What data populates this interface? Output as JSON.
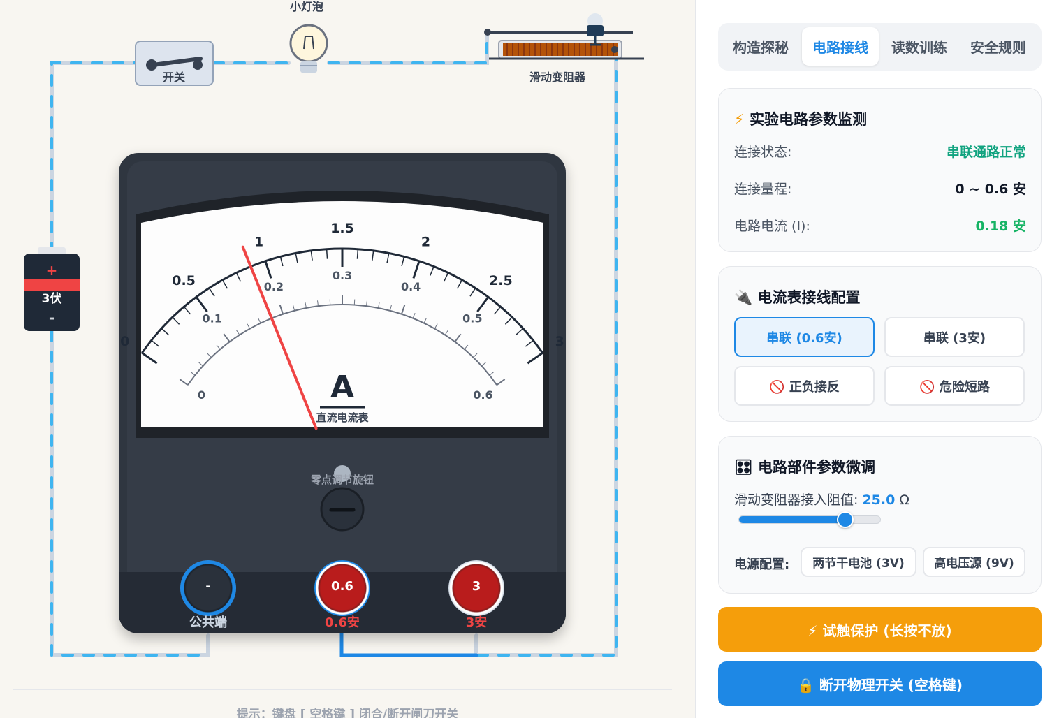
{
  "circuit": {
    "bulb_label": "小灯泡",
    "switch_label": "开关",
    "rheostat_label": "滑动变阻器",
    "battery": {
      "plus": "+",
      "voltage": "3伏",
      "minus": "-"
    },
    "hint": "提示：键盘 [ 空格键 ] 闭合/断开闸刀开关"
  },
  "meter": {
    "unit": "A",
    "name": "直流电流表",
    "zero_knob": "零点调节旋钮",
    "needle_reading": 0.18,
    "outer_scale": [
      "0",
      "0.5",
      "1",
      "1.5",
      "2",
      "2.5",
      "3"
    ],
    "inner_scale": [
      "0",
      "0.1",
      "0.2",
      "0.3",
      "0.4",
      "0.5",
      "0.6"
    ],
    "terminals": [
      {
        "symbol": "-",
        "label": "公共端"
      },
      {
        "symbol": "0.6",
        "label": "0.6安"
      },
      {
        "symbol": "3",
        "label": "3安"
      }
    ]
  },
  "tabs": [
    "构造探秘",
    "电路接线",
    "读数训练",
    "安全规则"
  ],
  "active_tab": "电路接线",
  "monitor": {
    "icon": "⚡",
    "title": "实验电路参数监测",
    "rows": [
      {
        "key": "连接状态:",
        "value": "串联通路正常",
        "color": "#10a37f"
      },
      {
        "key": "连接量程:",
        "value": "0 ~ 0.6 安",
        "color": "#111827"
      },
      {
        "key": "电路电流 (I):",
        "value": "0.18 安",
        "color": "#16b364"
      }
    ]
  },
  "wiring": {
    "icon": "🔌",
    "title": "电流表接线配置",
    "options": [
      "串联 (0.6安)",
      "串联 (3安)",
      "🚫 正负接反",
      "🚫 危险短路"
    ],
    "selected": "串联 (0.6安)"
  },
  "tuning": {
    "icon": "🎛",
    "title": "电路部件参数微调",
    "rheostat_label": "滑动变阻器接入阻值:",
    "rheostat_value": "25.0",
    "rheostat_unit": "Ω",
    "slider_fraction": 0.75,
    "power_label": "电源配置:",
    "power_options": [
      "两节干电池 (3V)",
      "高电压源 (9V)"
    ]
  },
  "actions": {
    "probe": "⚡ 试触保护 (长按不放)",
    "disconnect": "🔒 断开物理开关 (空格键)"
  },
  "colors": {
    "accent": "#1e88e5",
    "probe": "#f59e0b",
    "wire": "#3fb5f0",
    "needle": "#ef4444"
  }
}
